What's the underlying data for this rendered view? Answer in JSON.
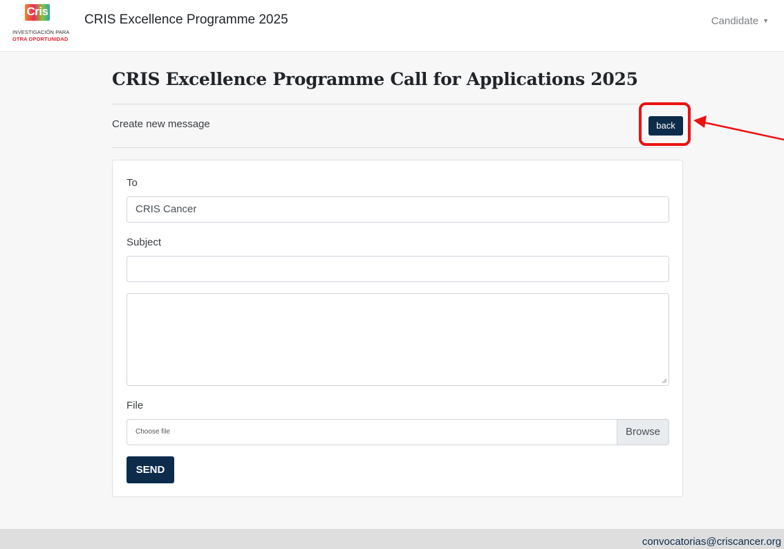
{
  "header": {
    "logo_text": "Cris",
    "logo_line1": "INVESTIGACIÓN PARA",
    "logo_line2": "OTRA OPORTUNIDAD",
    "title": "CRIS Excellence Programme 2025",
    "user_menu_label": "Candidate",
    "caret": "▼"
  },
  "main": {
    "page_title": "CRIS Excellence Programme Call for Applications 2025",
    "subheading": "Create new message",
    "back_label": "back"
  },
  "form": {
    "to_label": "To",
    "to_value": "CRIS Cancer",
    "subject_label": "Subject",
    "subject_value": "",
    "body_value": "",
    "file_label": "File",
    "file_placeholder": "Choose file",
    "browse_label": "Browse",
    "send_label": "SEND"
  },
  "footer": {
    "email": "convocatorias@criscancer.org"
  },
  "colors": {
    "primary": "#0d2c4b",
    "annotation": "#ee1111"
  }
}
